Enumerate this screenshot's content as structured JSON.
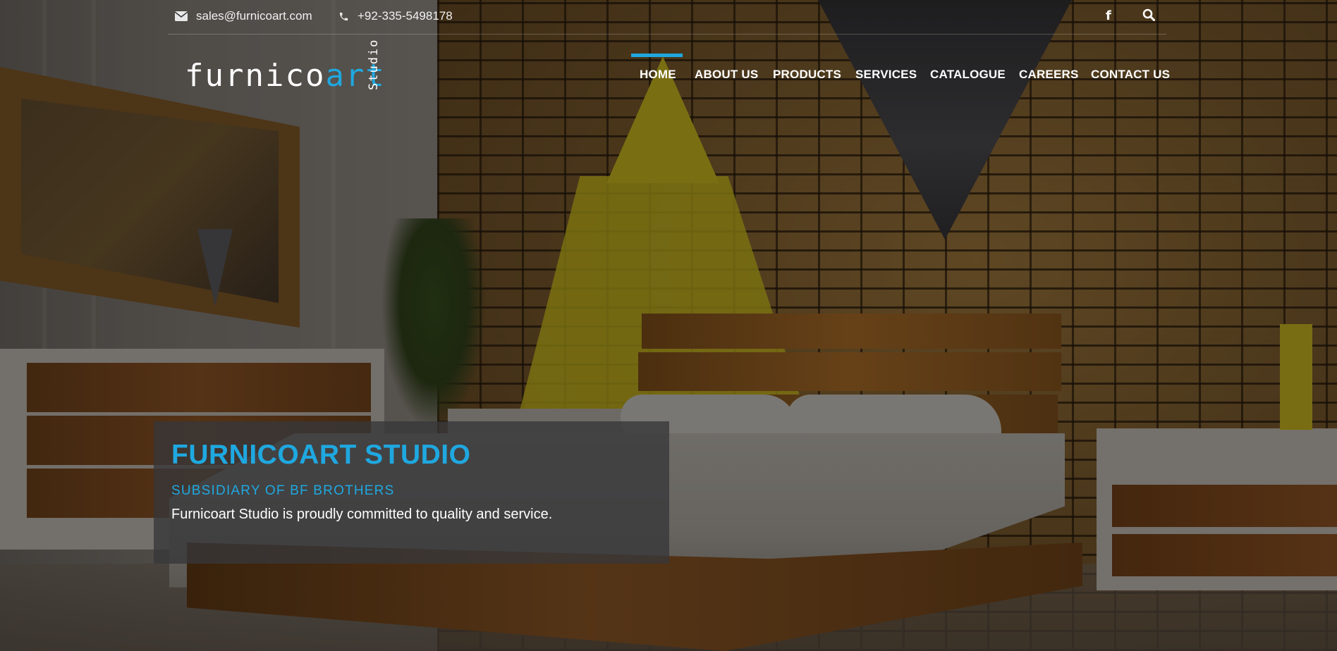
{
  "topbar": {
    "email": "sales@furnicoart.com",
    "phone": "+92-335-5498178",
    "email_icon": "envelope-icon",
    "phone_icon": "phone-icon",
    "facebook_icon": "facebook-icon",
    "search_icon": "search-icon"
  },
  "logo": {
    "main": "furnico",
    "accent": "art",
    "sub": "Studio"
  },
  "nav": {
    "items": [
      "HOME",
      "ABOUT US",
      "PRODUCTS",
      "SERVICES",
      "CATALOGUE",
      "CAREERS",
      "CONTACT US"
    ],
    "active": "HOME"
  },
  "hero": {
    "title": "FURNICOART STUDIO",
    "subtitle": "SUBSIDIARY OF BF BROTHERS",
    "text": "Furnicoart Studio is proudly committed to quality and service."
  },
  "colors": {
    "accent": "#1fa8e0",
    "text": "#ffffff",
    "hero_box": "#37373a"
  }
}
